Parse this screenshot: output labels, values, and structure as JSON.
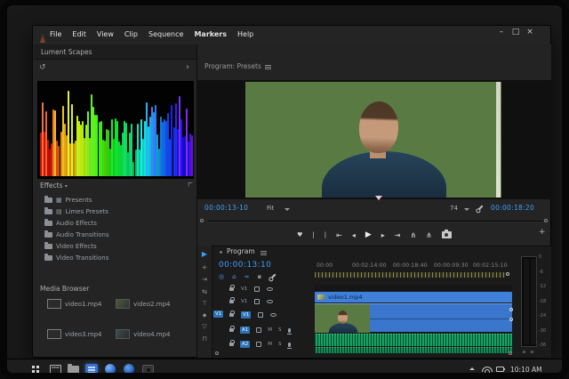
{
  "titlebar": {
    "menu": [
      "File",
      "Edit",
      "View",
      "Clip",
      "Sequence",
      "Markers",
      "Help"
    ],
    "window_controls": {
      "minimize": "–",
      "maximize": "□",
      "close": "×"
    }
  },
  "left_panel": {
    "tab_label": "Lument Scapes",
    "icons": {
      "refresh": "↺",
      "chevron_right": "›",
      "panel_corner": "∟",
      "dropdown": "▾"
    },
    "effects": {
      "title": "Effects",
      "badges": [
        "▦",
        "▤"
      ],
      "items": [
        "Presents",
        "Limes Presets",
        "Audio Effects",
        "Audio Transitions",
        "Video Effects",
        "Video Transitions"
      ]
    },
    "media_browser": {
      "title": "Media Browser",
      "files": [
        "video1.mp4",
        "video2.mp4",
        "video3.mp4",
        "video4.mp4"
      ]
    }
  },
  "program_monitor": {
    "title": "Program: Presets",
    "timecode_in": "00:00:13-10",
    "zoom_level": "Fit",
    "playback_resolution": "74",
    "timecode_out": "00:00:18:20",
    "transport": {
      "add_marker": "♥",
      "mark_in": "|",
      "mark_out": "|",
      "go_to_in": "⇤",
      "step_back": "◂",
      "play": "▶",
      "step_forward": "▸",
      "go_to_out": "⇥",
      "lift": "⋔",
      "extract": "⋔"
    },
    "add_button": "+"
  },
  "timeline": {
    "tab_label": "Program",
    "timecode": "00:00:13:10",
    "tools": [
      "▶",
      "+",
      "⇥",
      "⇆",
      "⊤",
      "◆",
      "▽",
      "⊓"
    ],
    "toggles": [
      "◎",
      "⌂",
      "≈",
      "▪"
    ],
    "ruler_labels": [
      "00:00",
      "00:02:14:00",
      "00:00:18:40",
      "00:00:09:30",
      "00:02:15:10"
    ],
    "source_patch": "V1",
    "tracks": {
      "video": [
        "V1",
        "V1",
        "V1"
      ],
      "audio": [
        "A1",
        "A2"
      ],
      "mute": "M",
      "solo": "S"
    },
    "clip_name": "video1.mp4"
  },
  "audio_meter": {
    "ticks": [
      "0",
      "-6",
      "-12",
      "-18",
      "-24",
      "-30",
      "-36"
    ]
  },
  "taskbar": {
    "time": "10:10 AM"
  },
  "colors": {
    "accent_blue": "#3f9ef5",
    "clip_blue": "#3f80da",
    "audio_green": "#17a463",
    "selection_blue": "#2e74b8"
  }
}
